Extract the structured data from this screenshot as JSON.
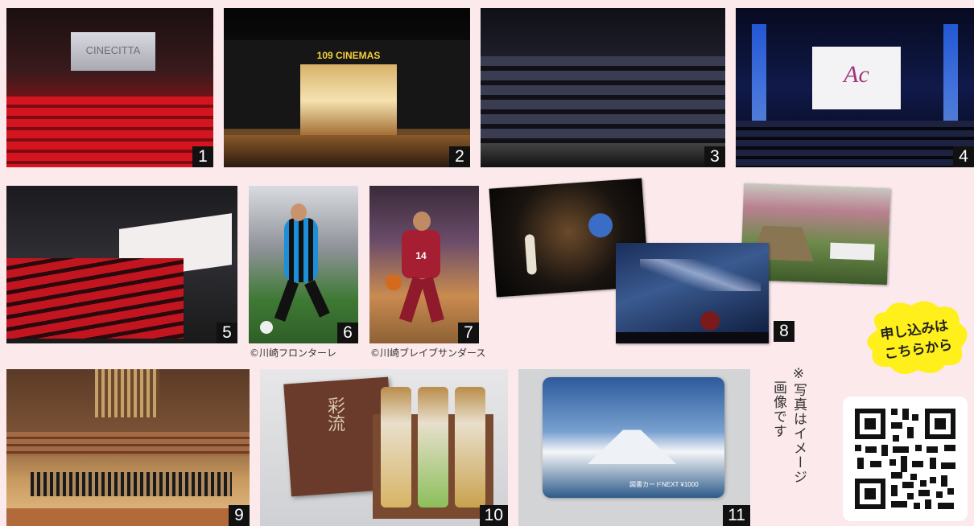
{
  "photos": [
    {
      "num": "1",
      "sign": "CINECITTA"
    },
    {
      "num": "2",
      "sign": "109 CINEMAS"
    },
    {
      "num": "3"
    },
    {
      "num": "4",
      "sign": "Ac"
    },
    {
      "num": "5"
    },
    {
      "num": "6",
      "caption": "©川崎フロンターレ"
    },
    {
      "num": "7",
      "caption": "©川崎ブレイブサンダース",
      "jersey": "14"
    },
    {
      "num": "8"
    },
    {
      "num": "9"
    },
    {
      "num": "10",
      "box_text": "彩流"
    },
    {
      "num": "11",
      "card_text": "図書カードNEXT ¥1000"
    }
  ],
  "note": {
    "line1": "※写真はイメージ",
    "line2": "画像です"
  },
  "apply": {
    "line1": "申し込みは",
    "line2": "こちらから"
  },
  "colors": {
    "background": "#fbe9ec",
    "cloud": "#ffef1a",
    "number_badge": "#111111"
  }
}
